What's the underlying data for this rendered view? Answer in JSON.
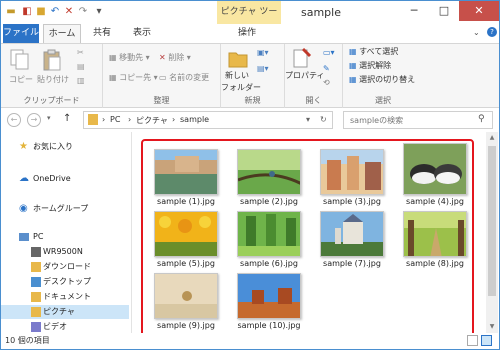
{
  "window": {
    "title": "sample",
    "context_tab_title": "ピクチャ ツール",
    "controls": {
      "minimize": "─",
      "maximize": "□",
      "close": "✕"
    }
  },
  "ribbon_tabs": {
    "file": "ファイル",
    "home": "ホーム",
    "share": "共有",
    "view": "表示",
    "manage": "操作"
  },
  "ribbon": {
    "clipboard": {
      "label": "クリップボード",
      "copy": "コピー",
      "paste": "貼り付け"
    },
    "organize": {
      "label": "整理",
      "move_to": "移動先",
      "copy_to": "コピー先",
      "delete": "削除",
      "rename": "名前の変更"
    },
    "new": {
      "label": "新規",
      "new_folder": "新しい",
      "new_folder_2": "フォルダー"
    },
    "open": {
      "label": "開く",
      "properties": "プロパティ"
    },
    "select": {
      "label": "選択",
      "select_all": "すべて選択",
      "select_none": "選択解除",
      "invert_selection": "選択の切り替え"
    }
  },
  "address": {
    "path": [
      "PC",
      "ピクチャ",
      "sample"
    ],
    "search_placeholder": "sampleの検索"
  },
  "nav_pane": {
    "favorites": "お気に入り",
    "onedrive": "OneDrive",
    "homegroup": "ホームグループ",
    "pc": "PC",
    "pc_items": [
      "WR9500N",
      "ダウンロード",
      "デスクトップ",
      "ドキュメント",
      "ピクチャ",
      "ビデオ"
    ]
  },
  "files": [
    "sample (1).jpg",
    "sample (2).jpg",
    "sample (3).jpg",
    "sample (4).jpg",
    "sample (5).jpg",
    "sample (6).jpg",
    "sample (7).jpg",
    "sample (8).jpg",
    "sample (9).jpg",
    "sample (10).jpg"
  ],
  "status": {
    "item_count": "10 個の項目"
  },
  "colors": {
    "accent": "#2b73c7",
    "highlight": "#e4161e",
    "selected": "#cce5f8",
    "context_tab": "#f9e7a2"
  }
}
